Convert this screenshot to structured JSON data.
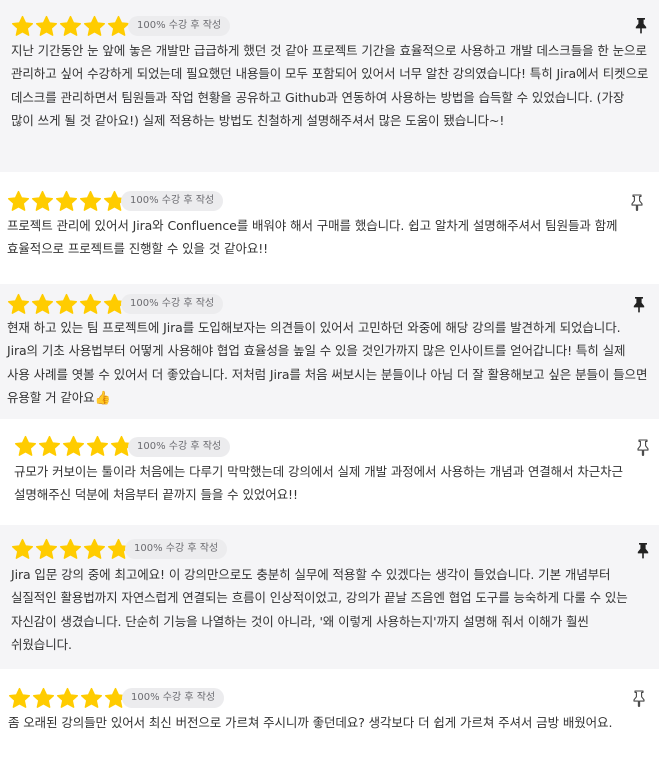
{
  "colors": {
    "star": "#FFCC00",
    "shaded_bg": "#f5f5f7",
    "badge_bg": "#ececee",
    "text": "#333333"
  },
  "icons": {
    "rating": "star-icon",
    "pin": "pin-icon"
  },
  "reviews": [
    {
      "rating": 5,
      "badge": "100% 수강 후 작성",
      "pinned": true,
      "text": "지난 기간동안 눈 앞에 놓은 개발만 급급하게 했던 것 같아 프로젝트 기간을 효율적으로 사용하고 개발 데스크들을 한 눈으로 관리하고 싶어 수강하게 되었는데 필요했던 내용들이 모두 포함되어 있어서 너무 알찬 강의였습니다! 특히 Jira에서 티켓으로 데스크를 관리하면서 팀원들과 작업 현황을 공유하고 Github과 연동하여 사용하는 방법을 습득할 수 있었습니다. (가장 많이 쓰게 될 것 같아요!) 실제 적용하는 방법도 친철하게 설명해주셔서 많은 도움이 됐습니다~!"
    },
    {
      "rating": 5,
      "badge": "100% 수강 후 작성",
      "pinned": false,
      "text": "프로젝트 관리에 있어서 Jira와 Confluence를 배워야 해서 구매를 했습니다. 쉽고 알차게 설명해주셔서 팀원들과 함께 효율적으로 프로젝트를 진행할 수 있을 것 같아요!!"
    },
    {
      "rating": 5,
      "badge": "100% 수강 후 작성",
      "pinned": true,
      "text": "현재 하고 있는 팀 프로젝트에 Jira를 도입해보자는 의견들이 있어서 고민하던 와중에 해당 강의를 발견하게 되었습니다. Jira의 기초 사용법부터 어떻게 사용해야 협업 효율성을 높일 수 있을 것인가까지 많은 인사이트를 얻어갑니다! 특히 실제 사용 사례를 엿볼 수 있어서 더 좋았습니다. 저처럼 Jira를 처음 써보시는 분들이나 아님 더 잘 활용해보고 싶은 분들이 들으면 유용할 거 같아요",
      "emoji": "👍"
    },
    {
      "rating": 5,
      "badge": "100% 수강 후 작성",
      "pinned": false,
      "text": "규모가 커보이는 툴이라 처음에는 다루기 막막했는데 강의에서 실제 개발 과정에서 사용하는 개념과 연결해서 차근차근 설명해주신 덕분에 처음부터 끝까지 들을 수 있었어요!!"
    },
    {
      "rating": 5,
      "badge": "100% 수강 후 작성",
      "pinned": true,
      "text": "Jira 입문 강의 중에 최고에요! 이 강의만으로도 충분히 실무에 적용할 수 있겠다는 생각이 들었습니다. 기본 개념부터 실질적인 활용법까지 자연스럽게 연결되는 흐름이 인상적이었고, 강의가 끝날 즈음엔 협업 도구를 능숙하게 다룰 수 있는 자신감이 생겼습니다. 단순히 기능을 나열하는 것이 아니라, '왜 이렇게 사용하는지'까지 설명해 줘서 이해가 훨씬 쉬웠습니다."
    },
    {
      "rating": 5,
      "badge": "100% 수강 후 작성",
      "pinned": false,
      "text": "좀 오래된 강의들만 있어서 최신 버전으로 가르쳐 주시니까 좋던데요? 생각보다 더 쉽게 가르쳐 주셔서 금방 배웠어요."
    }
  ]
}
